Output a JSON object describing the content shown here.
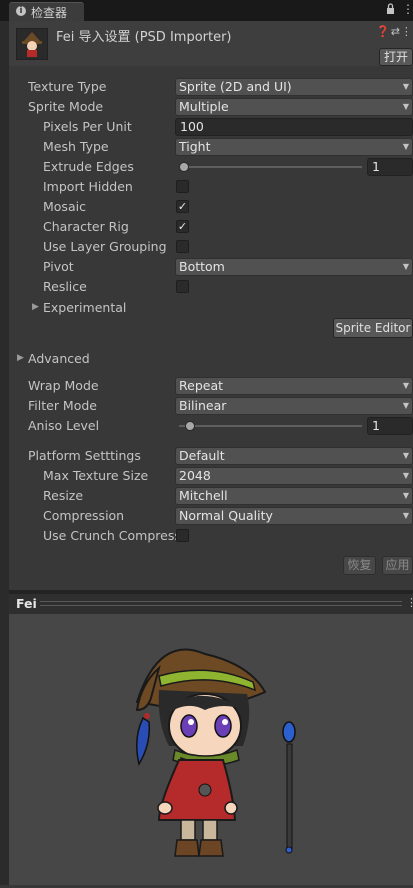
{
  "tab": {
    "title": "检查器",
    "icon": "info-icon"
  },
  "header": {
    "title": "Fei 导入设置 (PSD Importer)",
    "open_button": "打开",
    "icons": [
      "help-icon",
      "preset-icon",
      "menu-icon"
    ]
  },
  "settings": {
    "texture_type": {
      "label": "Texture Type",
      "value": "Sprite (2D and UI)"
    },
    "sprite_mode": {
      "label": "Sprite Mode",
      "value": "Multiple"
    },
    "pixels_per_unit": {
      "label": "Pixels Per Unit",
      "value": "100"
    },
    "mesh_type": {
      "label": "Mesh Type",
      "value": "Tight"
    },
    "extrude_edges": {
      "label": "Extrude Edges",
      "value": "1",
      "slider_fraction": 0.03
    },
    "import_hidden": {
      "label": "Import Hidden",
      "checked": false
    },
    "mosaic": {
      "label": "Mosaic",
      "checked": true
    },
    "character_rig": {
      "label": "Character Rig",
      "checked": true
    },
    "use_layer_grouping": {
      "label": "Use Layer Grouping",
      "checked": false
    },
    "pivot": {
      "label": "Pivot",
      "value": "Bottom"
    },
    "reslice": {
      "label": "Reslice",
      "checked": false
    },
    "experimental": {
      "label": "Experimental"
    },
    "sprite_editor_button": "Sprite Editor",
    "advanced": {
      "label": "Advanced"
    },
    "wrap_mode": {
      "label": "Wrap Mode",
      "value": "Repeat"
    },
    "filter_mode": {
      "label": "Filter Mode",
      "value": "Bilinear"
    },
    "aniso_level": {
      "label": "Aniso Level",
      "value": "1",
      "slider_fraction": 0.06
    },
    "platform_settings": {
      "label": "Platform Setttings",
      "value": "Default"
    },
    "max_texture_size": {
      "label": "Max Texture Size",
      "value": "2048"
    },
    "resize": {
      "label": "Resize",
      "value": "Mitchell"
    },
    "compression": {
      "label": "Compression",
      "value": "Normal Quality"
    },
    "use_crunch_compression": {
      "label": "Use Crunch Compress",
      "checked": false
    }
  },
  "footer": {
    "revert_button": "恢复",
    "apply_button": "应用"
  },
  "preview": {
    "title": "Fei"
  },
  "colors": {
    "panel": "#383838",
    "field": "#2a2a2a",
    "dropdown": "#515151",
    "preview_bg": "#474747"
  }
}
